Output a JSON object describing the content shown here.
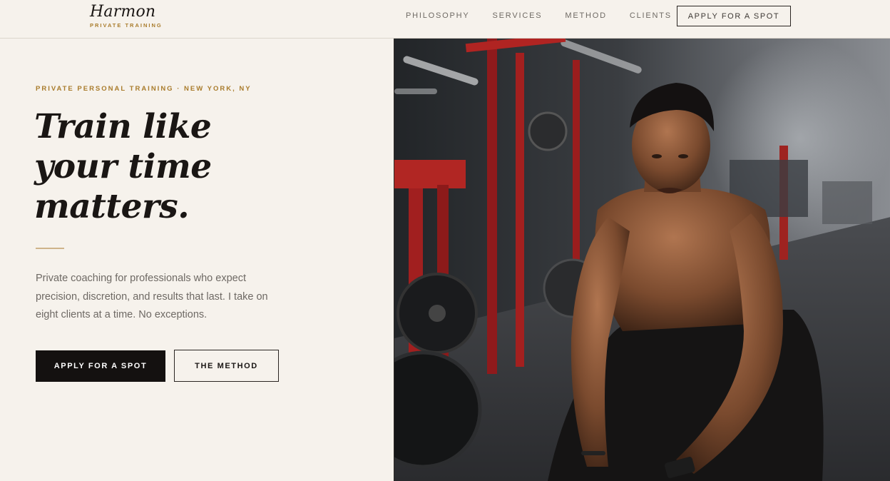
{
  "brand": {
    "name": "Harmon",
    "tagline": "PRIVATE TRAINING"
  },
  "nav": {
    "items": [
      {
        "label": "PHILOSOPHY"
      },
      {
        "label": "SERVICES"
      },
      {
        "label": "METHOD"
      },
      {
        "label": "CLIENTS"
      }
    ],
    "cta_label": "APPLY FOR A SPOT"
  },
  "hero": {
    "eyebrow": "PRIVATE PERSONAL TRAINING · NEW YORK, NY",
    "headline_lines": [
      "Train like",
      "your time",
      "matters."
    ],
    "intro": "Private coaching for professionals who expect precision, discretion, and results that last. I take on eight clients at a time. No exceptions.",
    "primary_button": "APPLY FOR A SPOT",
    "secondary_button": "THE METHOD"
  },
  "colors": {
    "background": "#f6f2ec",
    "accent_gold": "#a97c2c",
    "ink": "#1a1614",
    "muted_text": "#6e6964"
  },
  "icons": {
    "hero_photo": "gym-athlete-photo"
  }
}
